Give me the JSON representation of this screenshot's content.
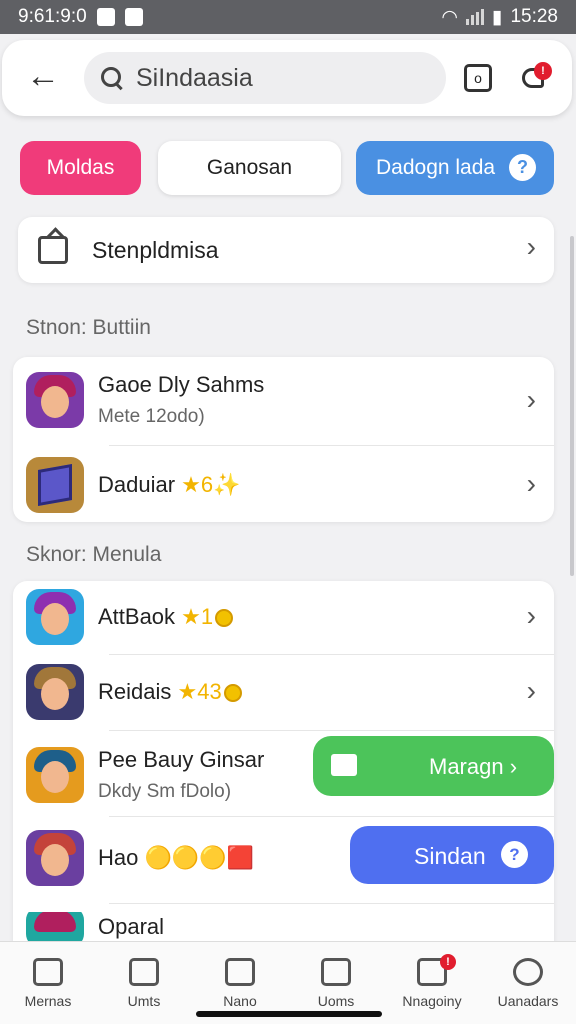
{
  "status": {
    "time": "9:61:9:0",
    "time_right": "15:28",
    "battery": "▮"
  },
  "search": {
    "query": "SiIndaasia"
  },
  "header": {
    "camera_glyph": "o",
    "notify_badge": "!"
  },
  "chips": [
    {
      "label": "Moldas"
    },
    {
      "label": "Ganosan"
    },
    {
      "label": "Dadogn lada",
      "help": "?"
    }
  ],
  "settings": {
    "label": "Stenpldmisa",
    "chevron": "›"
  },
  "section1": {
    "title": "Stnon: Buttiin"
  },
  "section2": {
    "title": "Sknor: Menula"
  },
  "items": [
    {
      "title": "Gaoe Dly Sahms",
      "sub": "Mete 12odo)",
      "chevron": "›"
    },
    {
      "title": "Daduiar",
      "extras": "★6✨",
      "chevron": "›"
    },
    {
      "title": "AttBaok",
      "extras": "★1",
      "chevron": "›"
    },
    {
      "title": "Reidais",
      "extras": "★43",
      "chevron": "›"
    },
    {
      "title": "Pee Bauy Ginsar",
      "sub": "Dkdy Sm fDolo)"
    },
    {
      "title": "Hao",
      "extras": "🟡🟡🟡🟥"
    },
    {
      "title": "Oparal"
    }
  ],
  "fab_green": {
    "label": "Maragn ›"
  },
  "fab_blue": {
    "label": "Sindan",
    "help": "?"
  },
  "nav": [
    {
      "label": "Mernas"
    },
    {
      "label": "Umts"
    },
    {
      "label": "Nano"
    },
    {
      "label": "Uoms"
    },
    {
      "label": "Nnagoiny",
      "badge": "!"
    },
    {
      "label": "Uanadars"
    }
  ],
  "colors": {
    "pink": "#f03b7a",
    "blue": "#4a90e2",
    "green": "#4cc45a",
    "indigo": "#4f6ff0"
  }
}
